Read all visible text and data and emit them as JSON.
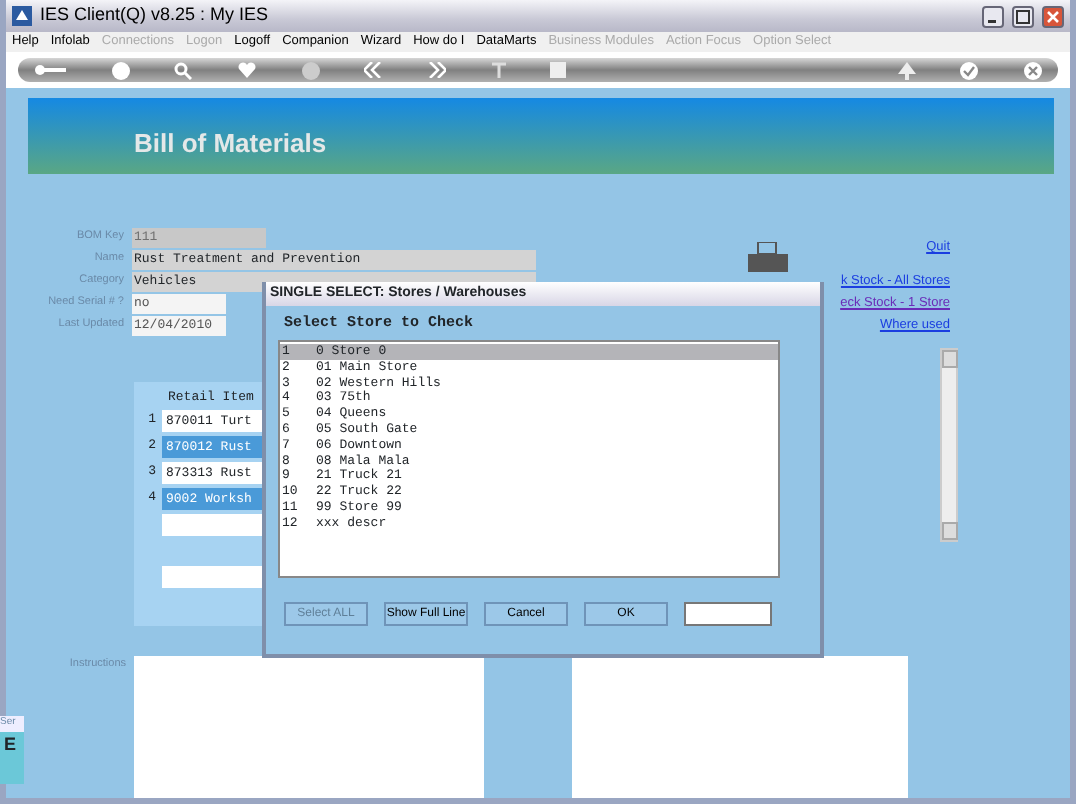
{
  "window": {
    "title": "IES Client(Q) v8.25 : My IES"
  },
  "menu": [
    {
      "label": "Help",
      "disabled": false
    },
    {
      "label": "Infolab",
      "disabled": false
    },
    {
      "label": "Connections",
      "disabled": true
    },
    {
      "label": "Logon",
      "disabled": true
    },
    {
      "label": "Logoff",
      "disabled": false
    },
    {
      "label": "Companion",
      "disabled": false
    },
    {
      "label": "Wizard",
      "disabled": false
    },
    {
      "label": "How do I",
      "disabled": false
    },
    {
      "label": "DataMarts",
      "disabled": false
    },
    {
      "label": "Business Modules",
      "disabled": true
    },
    {
      "label": "Action Focus",
      "disabled": true
    },
    {
      "label": "Option Select",
      "disabled": true
    }
  ],
  "page_title": "Bill of Materials",
  "form": {
    "fields": [
      {
        "label": "BOM Key",
        "value": "111",
        "kind": "short",
        "disabled": true
      },
      {
        "label": "Name",
        "value": "Rust Treatment and Prevention",
        "kind": "wide",
        "disabled": false
      },
      {
        "label": "Category",
        "value": "Vehicles",
        "kind": "wide",
        "disabled": false
      },
      {
        "label": "Need Serial # ?",
        "value": "no",
        "kind": "short",
        "disabled": false
      },
      {
        "label": "Last Updated",
        "value": "12/04/2010",
        "kind": "short",
        "disabled": false
      }
    ]
  },
  "retail_items": {
    "header": "Retail Item",
    "rows": [
      {
        "number": "1",
        "text": "870011 Turt"
      },
      {
        "number": "2",
        "text": "870012 Rust"
      },
      {
        "number": "3",
        "text": "873313 Rust"
      },
      {
        "number": "4",
        "text": "9002 Worksh"
      }
    ]
  },
  "quit_link": "Quit",
  "links": [
    {
      "label": "k Stock - All Stores",
      "visited": false
    },
    {
      "label": "eck Stock - 1 Store",
      "visited": true
    },
    {
      "label": "Where used",
      "visited": false
    }
  ],
  "instructions_label": "Instructions",
  "side_tab": {
    "label": "Ser",
    "key": "E"
  },
  "dialog": {
    "title": "SINGLE SELECT: Stores / Warehouses",
    "heading": "Select Store to Check",
    "items": [
      {
        "number": "1",
        "text": "0 Store 0",
        "selected": true
      },
      {
        "number": "2",
        "text": "01 Main Store",
        "selected": false
      },
      {
        "number": "3",
        "text": "02 Western Hills",
        "selected": false
      },
      {
        "number": "4",
        "text": "03 75th",
        "selected": false
      },
      {
        "number": "5",
        "text": "04 Queens",
        "selected": false
      },
      {
        "number": "6",
        "text": "05 South Gate",
        "selected": false
      },
      {
        "number": "7",
        "text": "06 Downtown",
        "selected": false
      },
      {
        "number": "8",
        "text": "08 Mala Mala",
        "selected": false
      },
      {
        "number": "9",
        "text": "21 Truck 21",
        "selected": false
      },
      {
        "number": "10",
        "text": "22 Truck 22",
        "selected": false
      },
      {
        "number": "11",
        "text": "99 Store 99",
        "selected": false
      },
      {
        "number": "12",
        "text": "xxx descr",
        "selected": false
      }
    ],
    "buttons": [
      {
        "label": "Select ALL",
        "disabled": true
      },
      {
        "label": "Show Full Line",
        "disabled": false
      },
      {
        "label": "Cancel",
        "disabled": false
      },
      {
        "label": "OK",
        "disabled": false
      }
    ]
  }
}
